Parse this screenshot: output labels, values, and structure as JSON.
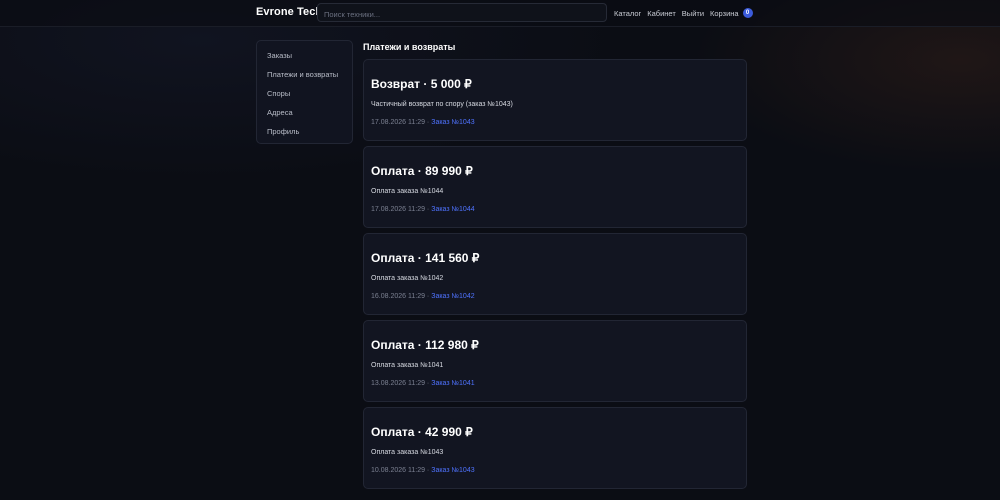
{
  "header": {
    "brand": "Evrone Tech",
    "search_placeholder": "Поиск техники...",
    "nav": {
      "catalog": "Каталог",
      "cabinet": "Кабинет",
      "logout": "Выйти",
      "cart": "Корзина",
      "cart_count": "0"
    },
    "cart_badge_color": "#3b5bdb"
  },
  "sidebar": {
    "items": [
      {
        "label": "Заказы"
      },
      {
        "label": "Платежи и возвраты"
      },
      {
        "label": "Споры"
      },
      {
        "label": "Адреса"
      },
      {
        "label": "Профиль"
      }
    ]
  },
  "main": {
    "title": "Платежи и возвраты",
    "link_color": "#4f73ff",
    "cards": [
      {
        "title": "Возврат · 5 000 ₽",
        "desc": "Частичный возврат по спору (заказ №1043)",
        "date": "17.08.2026 11:29",
        "sep": " · ",
        "link": "Заказ №1043"
      },
      {
        "title": "Оплата · 89 990 ₽",
        "desc": "Оплата заказа №1044",
        "date": "17.08.2026 11:29",
        "sep": " · ",
        "link": "Заказ №1044"
      },
      {
        "title": "Оплата · 141 560 ₽",
        "desc": "Оплата заказа №1042",
        "date": "16.08.2026 11:29",
        "sep": " · ",
        "link": "Заказ №1042"
      },
      {
        "title": "Оплата · 112 980 ₽",
        "desc": "Оплата заказа №1041",
        "date": "13.08.2026 11:29",
        "sep": " · ",
        "link": "Заказ №1041"
      },
      {
        "title": "Оплата · 42 990 ₽",
        "desc": "Оплата заказа №1043",
        "date": "10.08.2026 11:29",
        "sep": " · ",
        "link": "Заказ №1043"
      }
    ]
  }
}
